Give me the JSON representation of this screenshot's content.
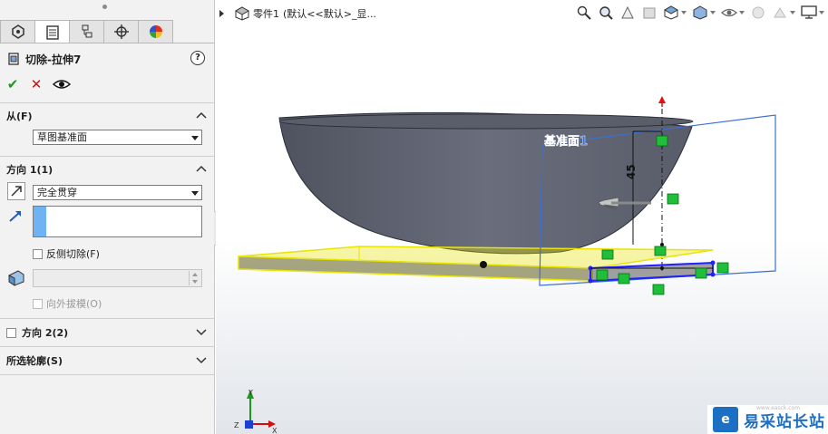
{
  "pm": {
    "tabs": [
      "feature-manager",
      "property-manager",
      "configuration-manager",
      "dimxpert-manager",
      "display-manager"
    ],
    "feature_title": "切除-拉伸7",
    "help_icon": "?",
    "from_label": "从(F)",
    "from_value": "草图基准面",
    "dir1_label": "方向 1(1)",
    "dir1_end_condition": "完全贯穿",
    "flip_side_label": "反侧切除(F)",
    "draft_outward_label": "向外拔模(O)",
    "dir2_label": "方向 2(2)",
    "contours_label": "所选轮廓(S)"
  },
  "graphics": {
    "breadcrumb_part": "零件1",
    "breadcrumb_config": "(默认<<默认>_显...",
    "plane_label": "基准面1",
    "dimension_value": "45",
    "watermark_text": "易采站长站",
    "watermark_url": "www.easck.com"
  },
  "colors": {
    "accept": "#1a9a1a",
    "cancel": "#d01010",
    "selection_blue": "#6fb3f2",
    "plane_border": "#3a6fd8",
    "extrude_preview": "#e9e400",
    "constraint_green": "#1fbf3a",
    "watermark_blue": "#1d6fc4"
  }
}
